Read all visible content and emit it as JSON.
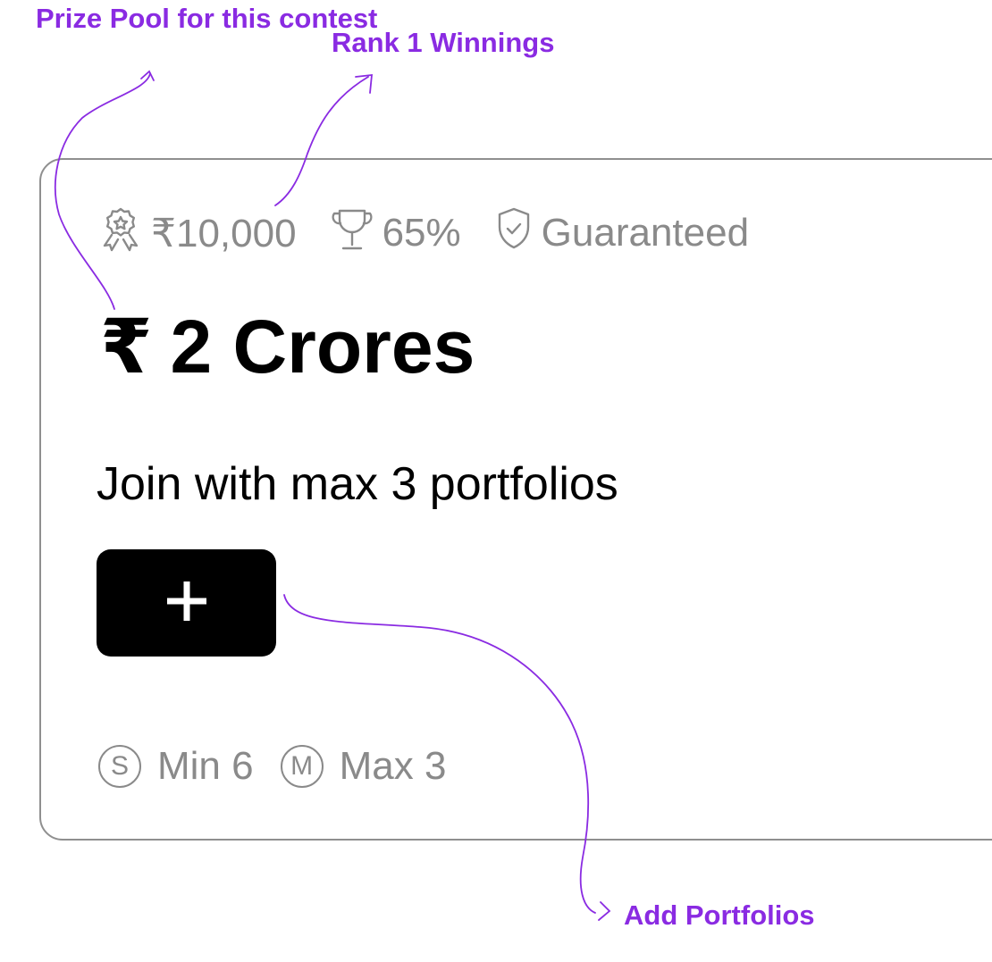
{
  "annotations": {
    "prize_pool": "Prize Pool for this contest",
    "rank1": "Rank 1 Winnings",
    "add_portfolios": "Add Portfolios"
  },
  "stats": {
    "rank1_winnings": "₹10,000",
    "winners_percent": "65%",
    "guaranteed": "Guaranteed",
    "icons": [
      "award-icon",
      "trophy-icon",
      "shield-check-icon"
    ]
  },
  "prize_pool": {
    "currency": "₹",
    "amount": "2 Crores"
  },
  "join_text": "Join with max 3 portfolios",
  "add_button": {
    "symbol": "+"
  },
  "limits": [
    {
      "badge": "S",
      "label": "Min 6"
    },
    {
      "badge": "M",
      "label": "Max 3"
    }
  ],
  "colors": {
    "annotation": "#8a2be2",
    "muted": "#8a8a8a",
    "button_bg": "#000000",
    "card_border": "#8f8f8f"
  }
}
